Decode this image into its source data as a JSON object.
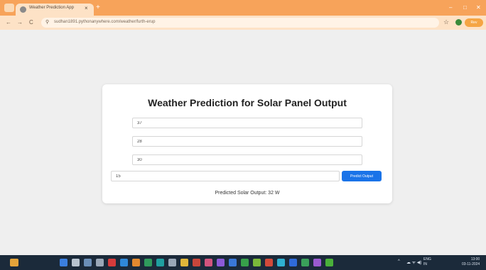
{
  "browser": {
    "tab_title": "Weather Prediction App",
    "url": "sudhan1891.pythonanywhere.com/weather/furth-erup",
    "new_tab_symbol": "+",
    "close_symbol": "×",
    "profile_label": "Rev"
  },
  "window_controls": {
    "minimize": "–",
    "maximize": "□",
    "close": "✕"
  },
  "nav": {
    "back": "←",
    "forward": "→",
    "reload": "C",
    "star": "☆"
  },
  "page": {
    "title": "Weather Prediction for Solar Panel Output",
    "inputs": [
      {
        "value": "37"
      },
      {
        "value": "28"
      },
      {
        "value": "30"
      },
      {
        "value": "15"
      }
    ],
    "predict_button": "Predict Output",
    "result": "Predicted Solar Output: 32 W"
  },
  "taskbar": {
    "icons": [
      {
        "name": "start-icon",
        "color": "#3b7fe0"
      },
      {
        "name": "search-icon",
        "color": "#b8c4d0"
      },
      {
        "name": "task-view-icon",
        "color": "#6b8fb8"
      },
      {
        "name": "widgets-icon",
        "color": "#9aa8b8"
      },
      {
        "name": "app-red-icon",
        "color": "#d63b3b"
      },
      {
        "name": "app-blue-icon",
        "color": "#2f88d8"
      },
      {
        "name": "app-orange-icon",
        "color": "#e2892f"
      },
      {
        "name": "app-green-icon",
        "color": "#2f9a5c"
      },
      {
        "name": "app-teal-icon",
        "color": "#1fa0a0"
      },
      {
        "name": "app-gray-icon",
        "color": "#9aa8b8"
      },
      {
        "name": "app-yellow-icon",
        "color": "#e0b63a"
      },
      {
        "name": "app-red2-icon",
        "color": "#c9463b"
      },
      {
        "name": "app-pink-icon",
        "color": "#d2547d"
      },
      {
        "name": "app-purple-icon",
        "color": "#8c5ad8"
      },
      {
        "name": "app-blue2-icon",
        "color": "#3a78d8"
      },
      {
        "name": "app-green2-icon",
        "color": "#37a04a"
      },
      {
        "name": "app-lime-icon",
        "color": "#7ab83a"
      },
      {
        "name": "app-red3-icon",
        "color": "#d24a3a"
      },
      {
        "name": "app-cyan-icon",
        "color": "#2fb0d0"
      },
      {
        "name": "app-blue3-icon",
        "color": "#2f6ad8"
      },
      {
        "name": "app-green3-icon",
        "color": "#3aa05a"
      },
      {
        "name": "app-violet-icon",
        "color": "#9a5ad0"
      },
      {
        "name": "app-green4-icon",
        "color": "#4ab03a"
      }
    ],
    "tray_chevron": "^",
    "tray_status": "☁  ᯤ ◀)",
    "lang_line1": "ENG",
    "lang_line2": "IN",
    "time": "13:00",
    "date": "03-11-2024"
  }
}
